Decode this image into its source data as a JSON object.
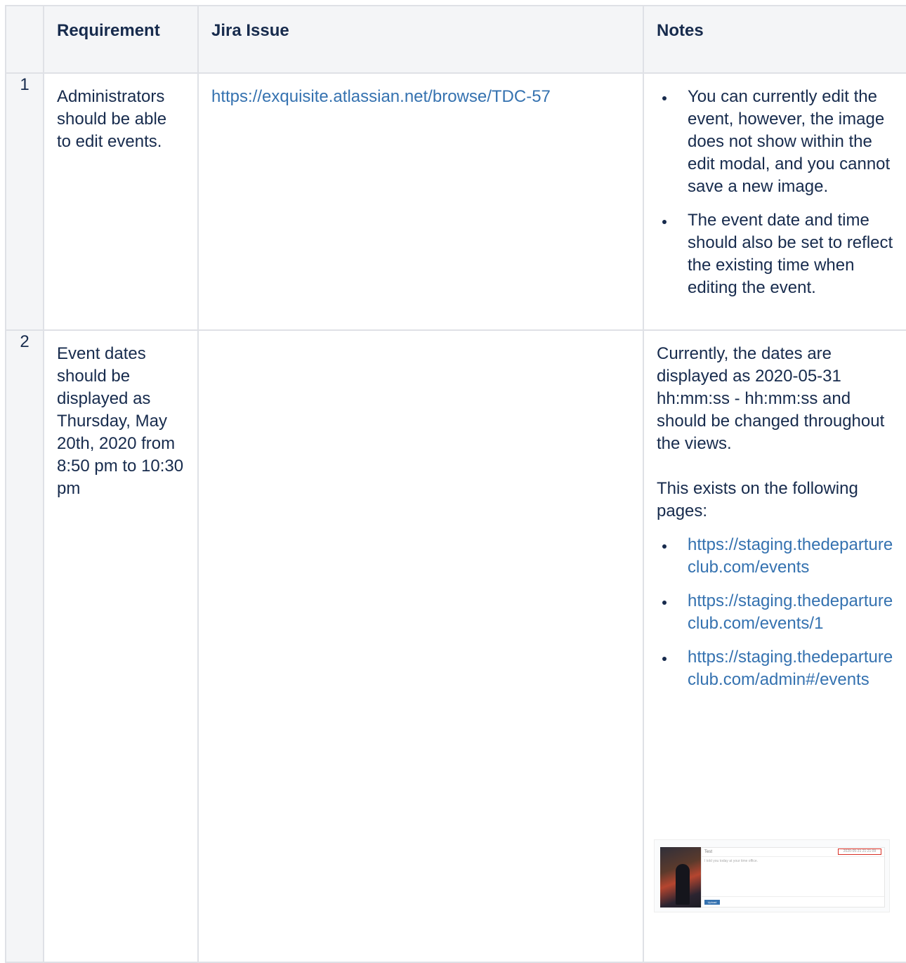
{
  "table": {
    "headers": {
      "number": "",
      "requirement": "Requirement",
      "jira": "Jira Issue",
      "notes": "Notes"
    },
    "rows": [
      {
        "number": "1",
        "requirement": "Administrators should be able to edit events.",
        "jira_link": "https://exquisite.atlassian.net/browse/TDC-57",
        "notes_bullets": [
          "You can currently edit the event, however, the image does not show within the edit modal, and you cannot save a new image.",
          "The event date and time should also be set to reflect the existing time when editing the event."
        ]
      },
      {
        "number": "2",
        "requirement": "Event dates should be displayed as Thursday, May 20th, 2020 from 8:50 pm to 10:30 pm",
        "jira_link": "",
        "notes_paragraph_1": "Currently, the dates are displayed as 2020-05-31 hh:mm:ss - hh:mm:ss and should be changed throughout the views.",
        "notes_paragraph_2": "This exists on the following pages:",
        "page_links": [
          "https://staging.thedepartureclub.com/events",
          "https://staging.thedepartureclub.com/events/1",
          "https://staging.thedepartureclub.com/admin#/events"
        ]
      }
    ]
  },
  "thumbnail": {
    "title": "Test",
    "date": "2020-05-31 21:21:09",
    "body": "I told you today at your time office.",
    "button": "Upload Event"
  }
}
